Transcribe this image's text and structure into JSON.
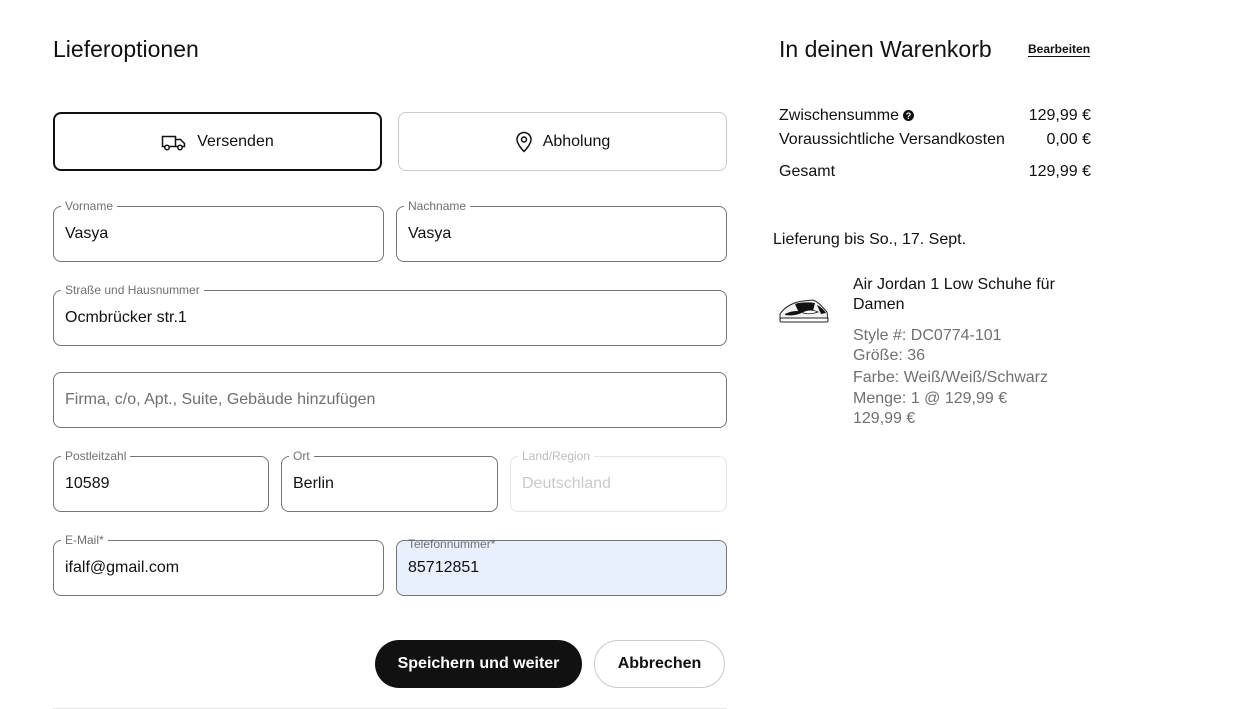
{
  "delivery": {
    "title": "Lieferoptionen",
    "options": [
      {
        "label": "Versenden",
        "icon": "truck-icon",
        "selected": true
      },
      {
        "label": "Abholung",
        "icon": "location-pin-icon",
        "selected": false
      }
    ]
  },
  "form": {
    "first_name": {
      "label": "Vorname",
      "value": "Vasya"
    },
    "last_name": {
      "label": "Nachname",
      "value": "Vasya"
    },
    "street": {
      "label": "Straße und Hausnummer",
      "value": "Ocmbrücker str.1"
    },
    "address2": {
      "placeholder": "Firma, c/o, Apt., Suite, Gebäude hinzufügen"
    },
    "postal_code": {
      "label": "Postleitzahl",
      "value": "10589"
    },
    "city": {
      "label": "Ort",
      "value": "Berlin"
    },
    "country": {
      "label": "Land/Region",
      "value": "Deutschland"
    },
    "email": {
      "label": "E-Mail*",
      "value": "ifalf@gmail.com"
    },
    "phone": {
      "label": "Telefonnummer*",
      "value": "85712851"
    }
  },
  "actions": {
    "save": "Speichern und weiter",
    "cancel": "Abbrechen"
  },
  "cart": {
    "title": "In deinen Warenkorb",
    "edit": "Bearbeiten",
    "subtotal_label": "Zwischensumme",
    "subtotal_value": "129,99 €",
    "shipping_label": "Voraussichtliche Versandkosten",
    "shipping_value": "0,00 €",
    "total_label": "Gesamt",
    "total_value": "129,99 €",
    "delivery_date": "Lieferung bis So., 17. Sept.",
    "item": {
      "name": "Air Jordan 1 Low Schuhe für Damen",
      "style": "Style #: DC0774-101",
      "size": "Größe: 36",
      "color": "Farbe: Weiß/Weiß/Schwarz",
      "quantity": "Menge: 1 @ 129,99 €",
      "price": "129,99 €"
    }
  },
  "colors": {
    "primary": "#111111",
    "muted_text": "#707072",
    "border": "#757575",
    "light_border": "#cacacb",
    "autofill_bg": "#e8f0fe"
  }
}
